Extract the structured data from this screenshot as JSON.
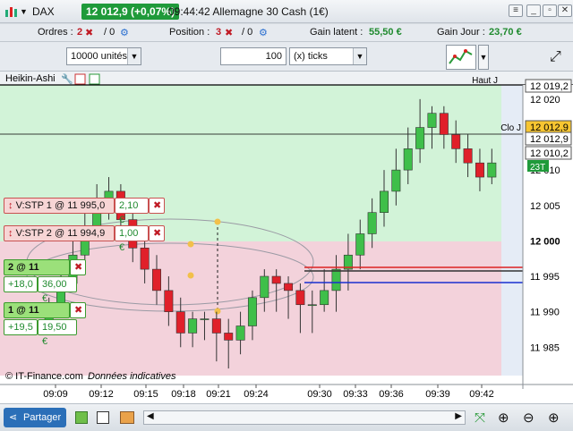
{
  "title": {
    "symbol": "DAX",
    "price_change": "12 012,9 (+0,07%)",
    "info": "09:44:42 Allemagne 30 Cash (1€)"
  },
  "header": {
    "orders_label": "Ordres :",
    "orders_count": "2",
    "orders_zero": "/ 0",
    "position_label": "Position :",
    "position_count": "3",
    "position_zero": "/ 0",
    "latent_label": "Gain latent :",
    "latent_value": "55,50 €",
    "day_label": "Gain Jour :",
    "day_value": "23,70 €"
  },
  "toolbar": {
    "units": "10000 unités",
    "qty": "100",
    "ticks": "(x) ticks"
  },
  "chart": {
    "indicator": "Heikin-Ashi",
    "copyright": "© IT-Finance.com",
    "disclaimer": "Données indicatives",
    "haut_label": "Haut J",
    "haut_value": "12 019,2",
    "clo_label": "Clo J",
    "price_tag": "12 012,9",
    "price_tag2": "12 012,9",
    "price_tag3": "12 010,2",
    "tick_count": "23T",
    "y_ticks": [
      "12 020",
      "12 015",
      "12 010",
      "12 005",
      "12 000",
      "11 995",
      "11 990",
      "11 985"
    ],
    "x_ticks": [
      "09:09",
      "09:12",
      "09:15",
      "09:18",
      "09:21",
      "09:24",
      "09:30",
      "09:33",
      "09:36",
      "09:39",
      "09:42"
    ],
    "orders": [
      {
        "label": "V:STP  1 @ 11 995,0",
        "amount": "2,10 €"
      },
      {
        "label": "V:STP  2 @ 11 994,9",
        "amount": "1,00 €"
      }
    ],
    "positions": [
      {
        "label": "2 @ 11 994,4",
        "pts": "+18,0",
        "amount": "36,00 €"
      },
      {
        "label": "1 @ 11 992,9",
        "pts": "+19,5",
        "amount": "19,50 €"
      }
    ]
  },
  "colors": {
    "up": "#3fbf4a",
    "down": "#e0202a",
    "bg_green": "#d2f3d8",
    "bg_pink": "#f3d2db",
    "badge": "#1f9a3a"
  },
  "bottom": {
    "share_label": "Partager"
  },
  "chart_data": {
    "type": "candlestick",
    "ylim": [
      11981,
      12022
    ],
    "candles": [
      [
        11988,
        11991,
        11987,
        11992
      ],
      [
        11991,
        11994,
        11990,
        11996
      ],
      [
        11994,
        11998,
        11993,
        12000
      ],
      [
        11998,
        12002,
        11996,
        12004
      ],
      [
        12002,
        12005,
        12000,
        12008
      ],
      [
        12005,
        12007,
        12003,
        12009
      ],
      [
        12007,
        12003,
        12002,
        12008
      ],
      [
        12003,
        11999,
        11997,
        12004
      ],
      [
        11999,
        11996,
        11994,
        12001
      ],
      [
        11996,
        11993,
        11991,
        11998
      ],
      [
        11993,
        11990,
        11988,
        11995
      ],
      [
        11990,
        11987,
        11985,
        11992
      ],
      [
        11987,
        11989,
        11985,
        11990
      ],
      [
        11989,
        11989,
        11986,
        11990
      ],
      [
        11989,
        11987,
        11983,
        11990
      ],
      [
        11987,
        11986,
        11982,
        11989
      ],
      [
        11986,
        11988,
        11984,
        11990
      ],
      [
        11988,
        11992,
        11986,
        11993
      ],
      [
        11992,
        11995,
        11990,
        11996
      ],
      [
        11995,
        11994,
        11990,
        11996
      ],
      [
        11994,
        11993,
        11989,
        11995
      ],
      [
        11993,
        11991,
        11987,
        11994
      ],
      [
        11991,
        11991,
        11987,
        11993
      ],
      [
        11991,
        11993,
        11990,
        11996
      ],
      [
        11993,
        11996,
        11990,
        11998
      ],
      [
        11996,
        11998,
        11993,
        12001
      ],
      [
        11998,
        12001,
        11996,
        12003
      ],
      [
        12001,
        12004,
        11999,
        12006
      ],
      [
        12004,
        12007,
        12002,
        12010
      ],
      [
        12007,
        12010,
        12005,
        12013
      ],
      [
        12010,
        12013,
        12008,
        12016
      ],
      [
        12013,
        12016,
        12011,
        12020
      ],
      [
        12016,
        12018,
        12013,
        12019
      ],
      [
        12018,
        12015,
        12013,
        12019
      ],
      [
        12015,
        12013,
        12011,
        12017
      ],
      [
        12013,
        12011,
        12009,
        12015
      ],
      [
        12011,
        12009,
        12007,
        12013
      ],
      [
        12009,
        12011,
        12008,
        12013
      ]
    ]
  }
}
